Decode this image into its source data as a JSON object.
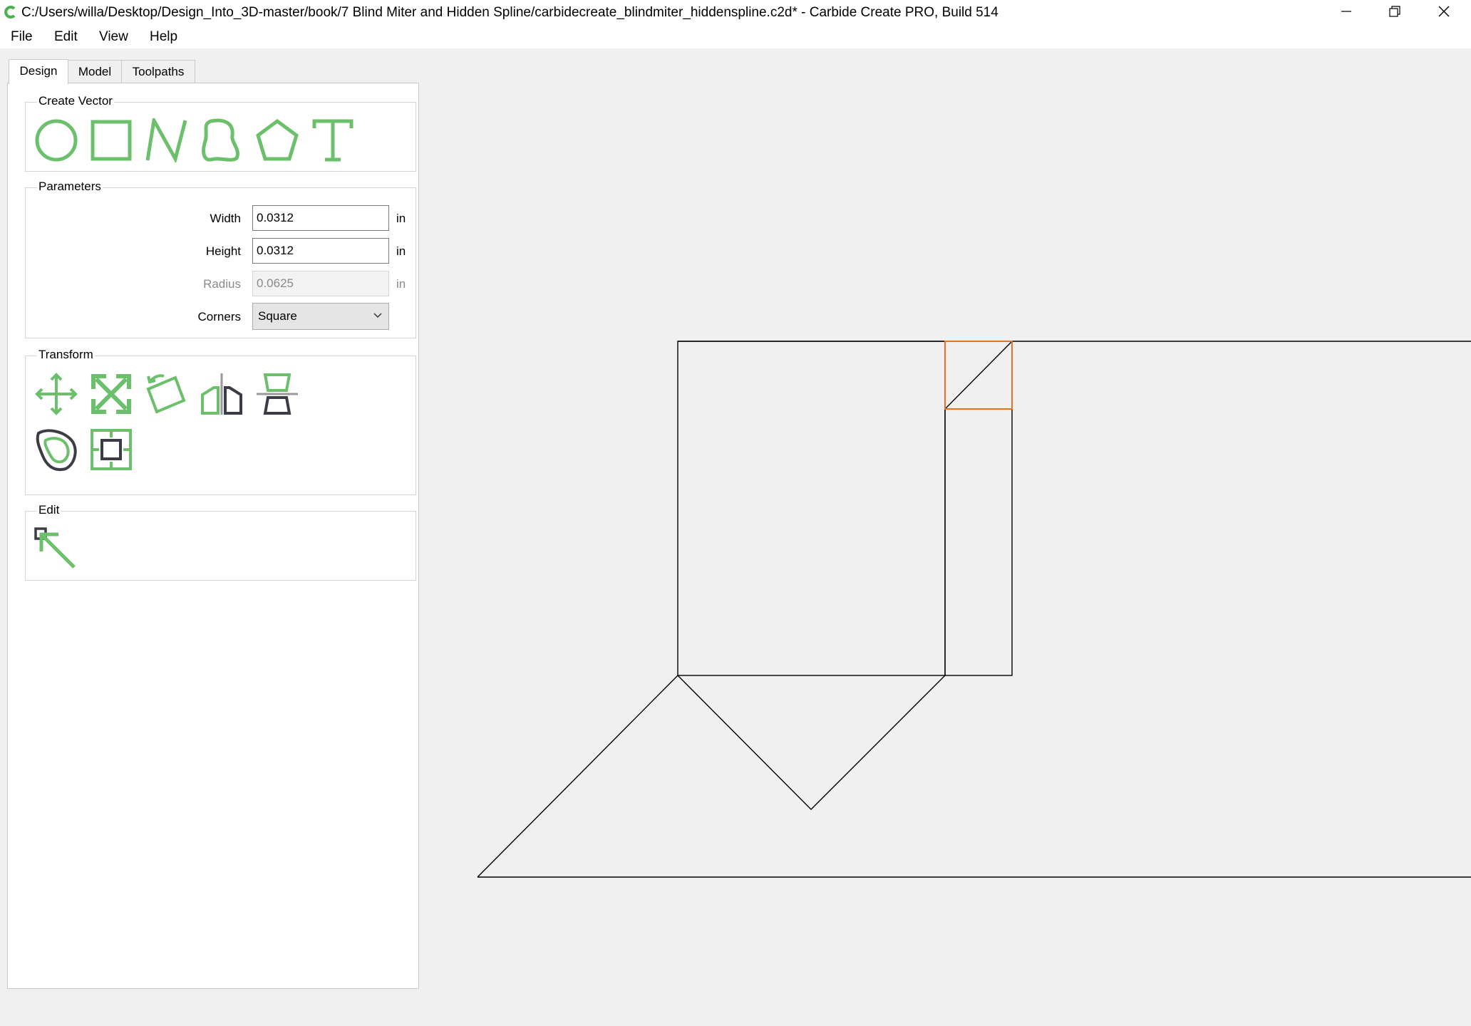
{
  "window": {
    "title": "C:/Users/willa/Desktop/Design_Into_3D-master/book/7 Blind Miter and Hidden Spline/carbidecreate_blindmiter_hiddenspline.c2d* - Carbide Create PRO, Build 514",
    "app_icon": "carbide-create-c-logo-icon",
    "controls": [
      "minimize-icon",
      "restore-icon",
      "close-icon"
    ]
  },
  "menu": {
    "file": "File",
    "edit": "Edit",
    "view": "View",
    "help": "Help"
  },
  "tabs": {
    "design": "Design",
    "model": "Model",
    "toolpaths": "Toolpaths",
    "active": "Design"
  },
  "create_vector": {
    "title": "Create Vector",
    "tools": [
      "circle-icon",
      "rectangle-icon",
      "polyline-icon",
      "curve-icon",
      "polygon-icon",
      "text-icon"
    ]
  },
  "parameters": {
    "title": "Parameters",
    "width_label": "Width",
    "width_value": "0.0312",
    "width_unit": "in",
    "height_label": "Height",
    "height_value": "0.0312",
    "height_unit": "in",
    "radius_label": "Radius",
    "radius_value": "0.0625",
    "radius_unit": "in",
    "corners_label": "Corners",
    "corners_value": "Square"
  },
  "transform": {
    "title": "Transform",
    "tools": [
      "move-icon",
      "scale-icon",
      "rotate-icon",
      "mirror-icon",
      "align-icon",
      "offset-icon",
      "boolean-icon"
    ]
  },
  "edit": {
    "title": "Edit",
    "tools": [
      "node-edit-icon"
    ]
  },
  "colors": {
    "accent_green": "#6cc06c",
    "selection_orange": "#e8731e",
    "icon_dark": "#3c3c46"
  }
}
